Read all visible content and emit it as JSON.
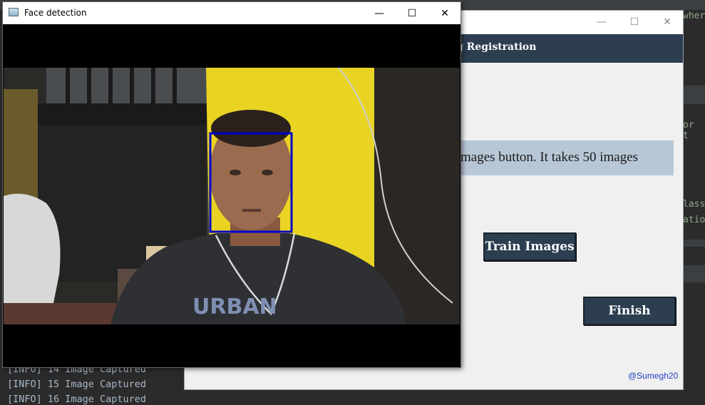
{
  "ide": {
    "right_fragments": [
      "wher",
      "or t",
      "lass",
      "atio"
    ],
    "console_lines": [
      "[INFO] 14 Image Captured",
      "[INFO] 15 Image Captured",
      "[INFO] 16 Image Captured"
    ]
  },
  "registration_window": {
    "controls": {
      "minimize": "—",
      "maximize": "☐",
      "close": "✕"
    },
    "header_title": "g Registration",
    "info_text": "mages button. It takes 50 images",
    "train_button": "Train Images",
    "finish_button": "Finish",
    "credit": "@Sumegh20",
    "colors": {
      "header": "#2c3e50",
      "info_box": "#b8c7d6",
      "button": "#2c3e50",
      "credit": "#1f3fbf"
    }
  },
  "face_window": {
    "title": "Face detection",
    "controls": {
      "minimize": "—",
      "maximize": "☐",
      "close": "✕"
    },
    "detection_box_color": "#0000cc",
    "shirt_text": "URBAN"
  }
}
